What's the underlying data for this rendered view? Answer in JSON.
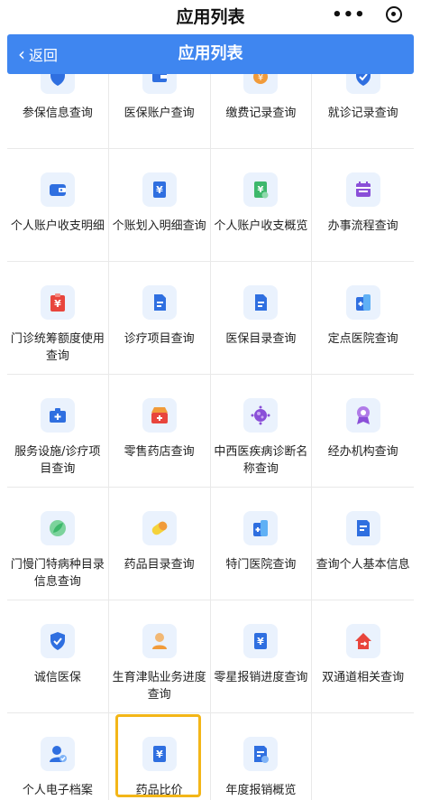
{
  "top_bar": {
    "title": "应用列表",
    "more_label": "•••"
  },
  "nav": {
    "back_label": "返回",
    "title": "应用列表"
  },
  "apps": [
    [
      "参保信息查询",
      "医保账户查询",
      "缴费记录查询",
      "就诊记录查询"
    ],
    [
      "个人账户收支明细",
      "个账划入明细查询",
      "个人账户收支概览",
      "办事流程查询"
    ],
    [
      "门诊统筹额度使用查询",
      "诊疗项目查询",
      "医保目录查询",
      "定点医院查询"
    ],
    [
      "服务设施/诊疗项目查询",
      "零售药店查询",
      "中西医疾病诊断名称查询",
      "经办机构查询"
    ],
    [
      "门慢门特病种目录信息查询",
      "药品目录查询",
      "特门医院查询",
      "查询个人基本信息"
    ],
    [
      "诚信医保",
      "生育津贴业务进度查询",
      "零星报销进度查询",
      "双通道相关查询"
    ],
    [
      "个人电子档案",
      "药品比价",
      "年度报销概览"
    ]
  ],
  "icons": [
    [
      "shield-icon",
      "wallet-card-icon",
      "coin-icon",
      "shield-check-icon"
    ],
    [
      "wallet-icon",
      "yuan-ticket-icon",
      "yuan-doc-icon",
      "calendar-icon"
    ],
    [
      "clipboard-yuan-icon",
      "document-icon",
      "document-icon",
      "hospital-building-icon"
    ],
    [
      "medical-kit-icon",
      "pharmacy-icon",
      "virus-icon",
      "badge-ribbon-icon"
    ],
    [
      "leaf-icon",
      "pill-icon",
      "hospital-building-icon",
      "id-document-icon"
    ],
    [
      "shield-check-icon",
      "person-icon",
      "yuan-ticket-icon",
      "house-arrow-icon"
    ],
    [
      "person-check-icon",
      "yuan-ticket-icon",
      "document-star-icon"
    ]
  ],
  "colors": {
    "nav_blue": "#3f86f0",
    "icon_blue": "#2f6fe0",
    "icon_red": "#e8453c",
    "icon_green": "#3db86b",
    "icon_purple": "#8a4fd8",
    "icon_orange": "#f19b3a",
    "highlight": "#f3b618"
  }
}
